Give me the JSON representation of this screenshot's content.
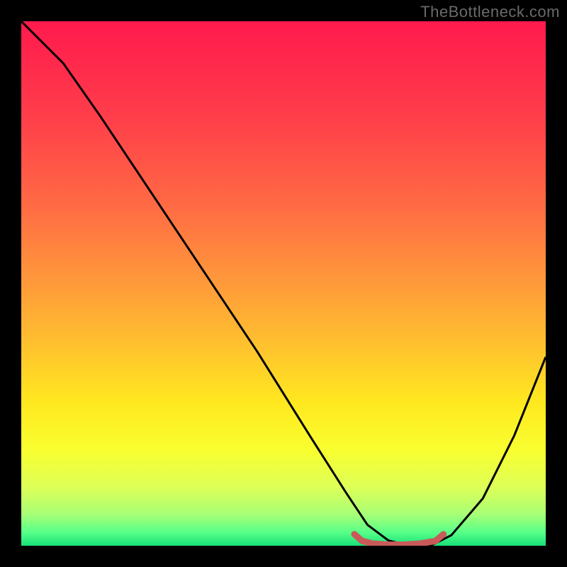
{
  "watermark": "TheBottleneck.com",
  "chart_data": {
    "type": "line",
    "title": "",
    "xlabel": "",
    "ylabel": "",
    "xlim": [
      0,
      100
    ],
    "ylim": [
      0,
      100
    ],
    "grid": false,
    "legend": false,
    "series": [
      {
        "name": "bottleneck-curve",
        "x": [
          0,
          3,
          8,
          15,
          25,
          35,
          45,
          55,
          62,
          66,
          70,
          74,
          78,
          82,
          88,
          94,
          100
        ],
        "y": [
          100,
          97,
          92,
          82,
          67,
          52,
          37,
          21,
          10,
          4,
          1,
          0,
          0,
          2,
          9,
          21,
          36
        ],
        "color": "#000000"
      },
      {
        "name": "optimal-zone-marker",
        "x": [
          63.5,
          65,
          67,
          70,
          73,
          76,
          79,
          80.5
        ],
        "y": [
          2.2,
          0.9,
          0.4,
          0.2,
          0.2,
          0.4,
          0.9,
          2.2
        ],
        "color": "#c95a5a"
      }
    ],
    "background_gradient": {
      "type": "vertical",
      "stops": [
        {
          "offset": 0.0,
          "color": "#ff1a4d"
        },
        {
          "offset": 0.18,
          "color": "#ff3d4a"
        },
        {
          "offset": 0.35,
          "color": "#ff6a44"
        },
        {
          "offset": 0.5,
          "color": "#ff9a3a"
        },
        {
          "offset": 0.62,
          "color": "#ffc22e"
        },
        {
          "offset": 0.73,
          "color": "#ffe91f"
        },
        {
          "offset": 0.82,
          "color": "#f8ff30"
        },
        {
          "offset": 0.89,
          "color": "#dcff58"
        },
        {
          "offset": 0.94,
          "color": "#a8ff76"
        },
        {
          "offset": 0.975,
          "color": "#56ff88"
        },
        {
          "offset": 1.0,
          "color": "#18e078"
        }
      ]
    }
  }
}
